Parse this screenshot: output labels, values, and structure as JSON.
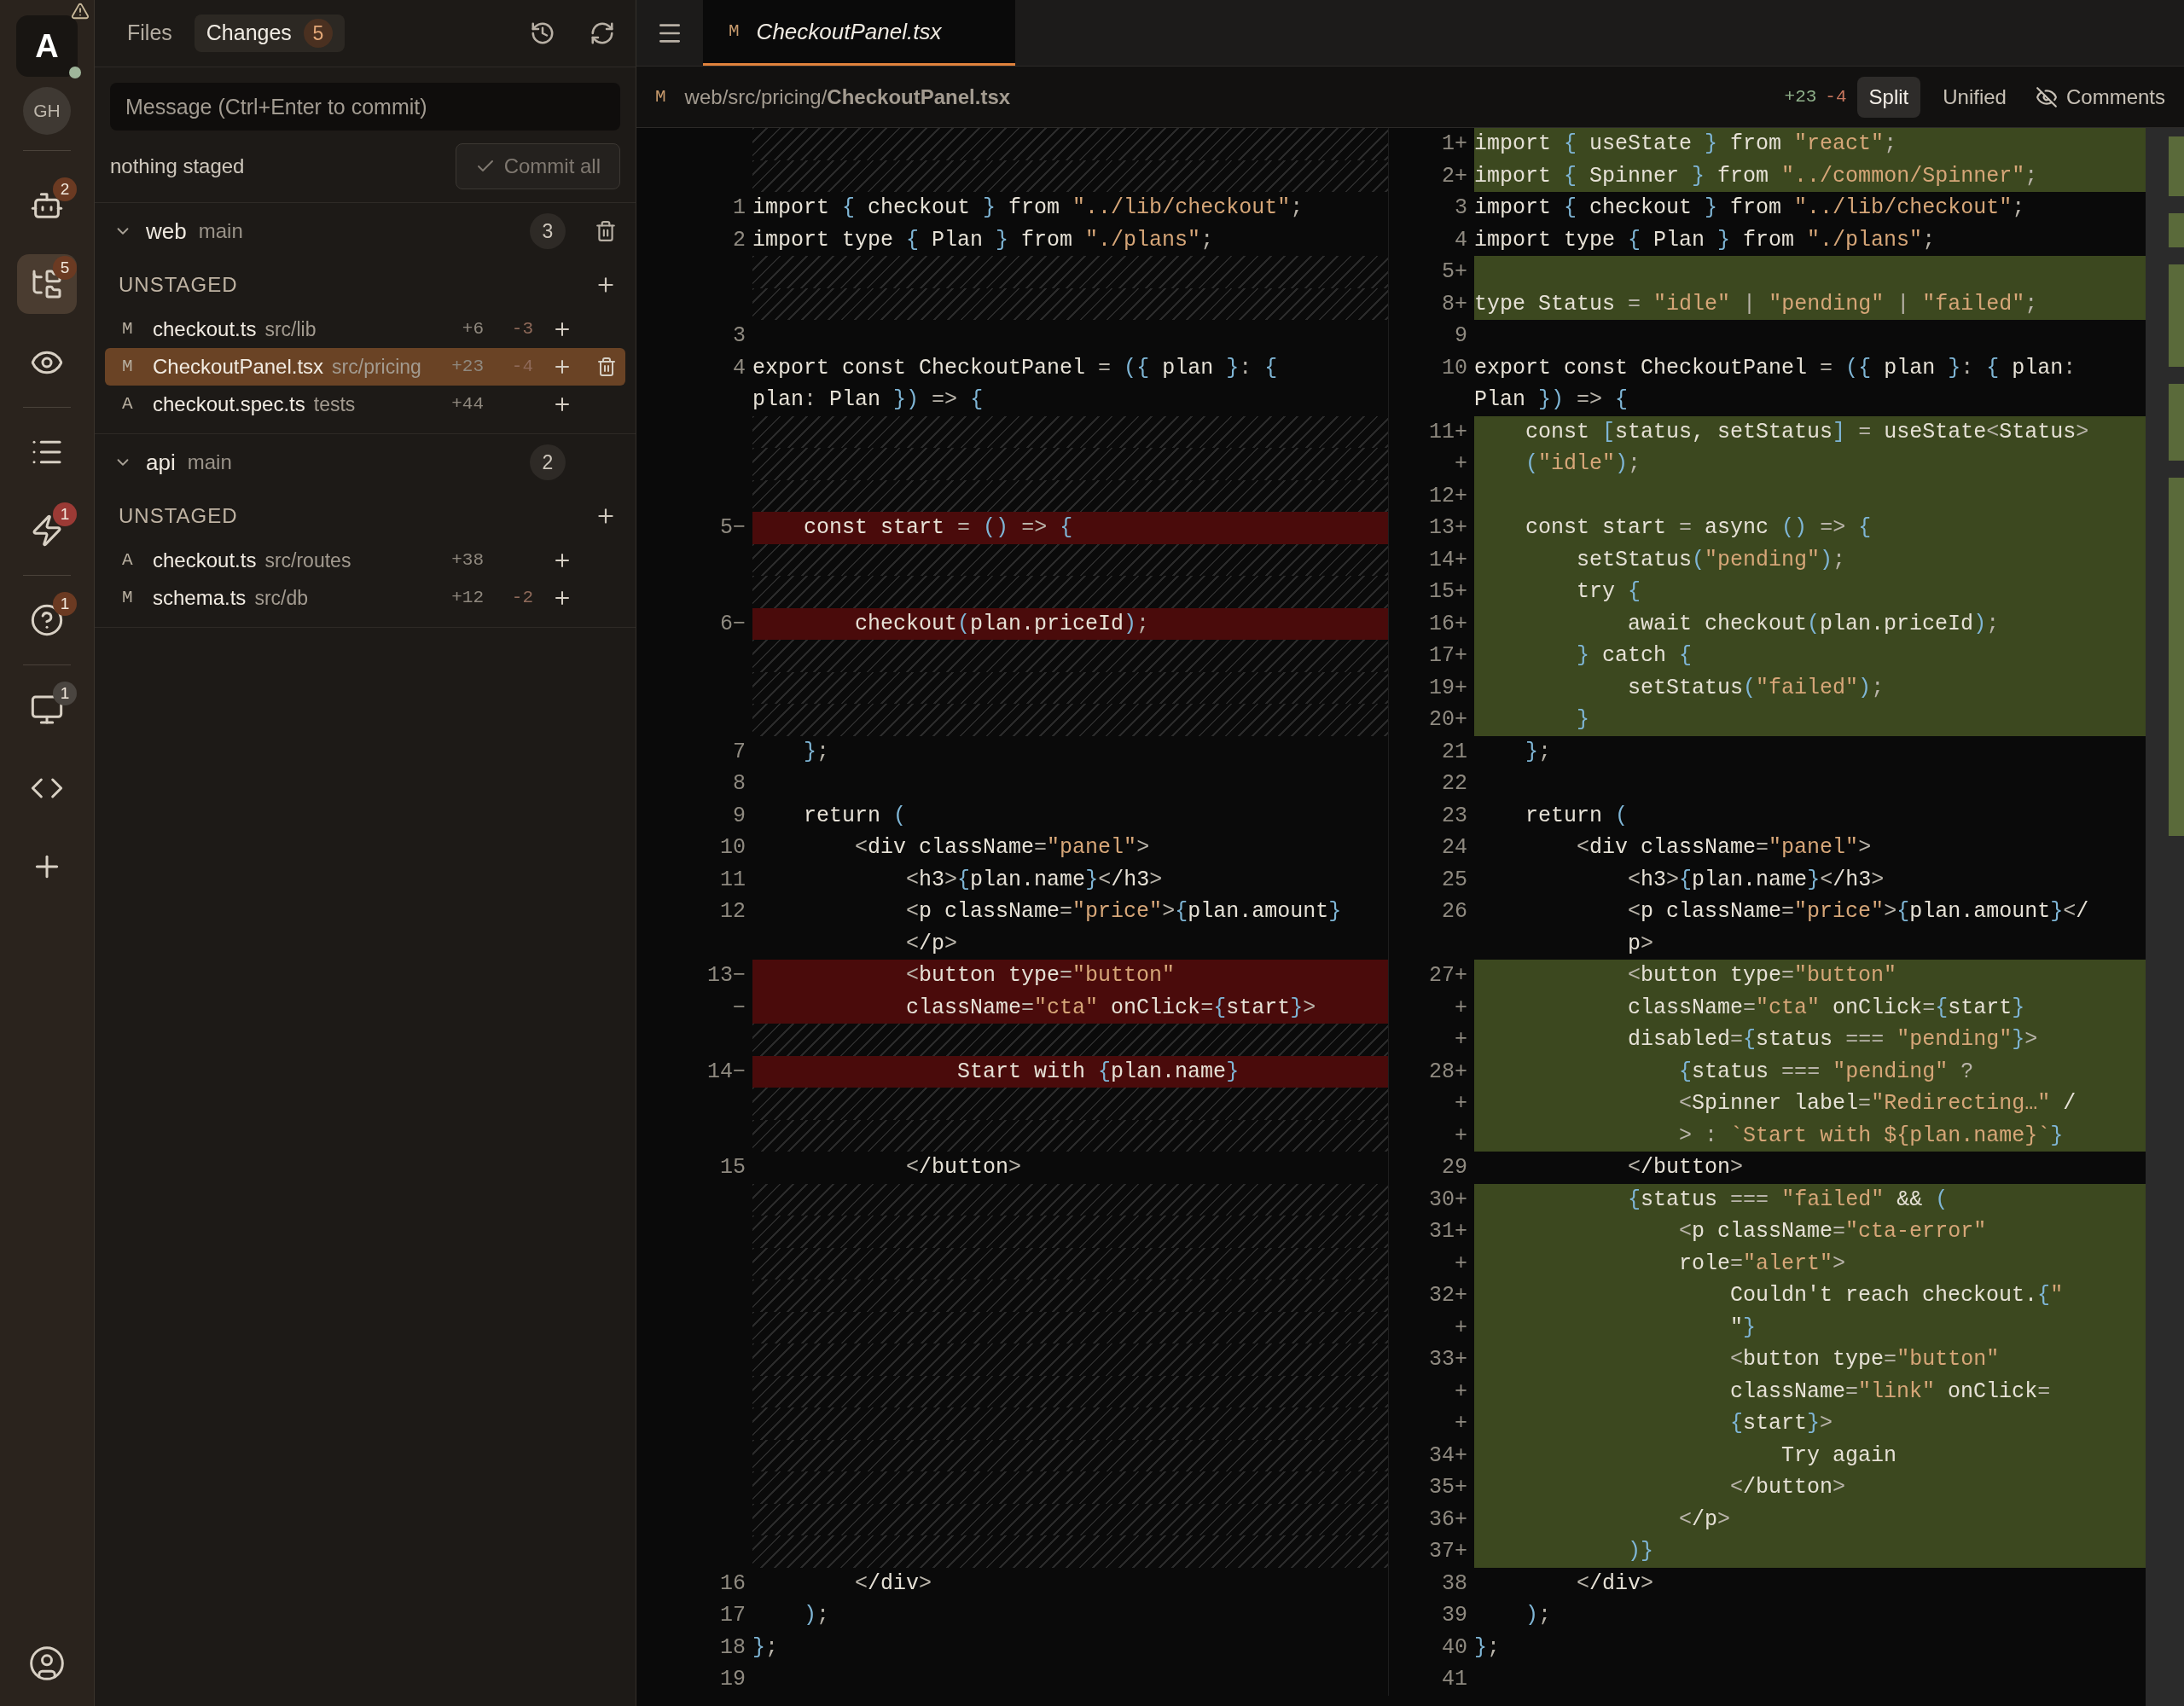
{
  "activity_bar": {
    "workspace": {
      "label": "A",
      "warning": true,
      "online": true
    },
    "account": {
      "label": "GH"
    },
    "items": [
      {
        "badge": "2",
        "color": "#6b3a22",
        "selected": false
      },
      {
        "badge": "5",
        "color": "#6b3a22",
        "selected": true
      },
      {
        "selected": false
      },
      {
        "selected": false
      },
      {
        "badge": "1",
        "color": "#9b3a35",
        "selected": false
      },
      {
        "badge": "1",
        "color": "#6b3a22",
        "selected": false
      },
      {
        "badge": "1",
        "color": "#4a4540",
        "selected": false
      },
      {
        "selected": false
      },
      {
        "selected": false
      }
    ]
  },
  "side_panel": {
    "tabs": [
      {
        "label": "Files",
        "selected": false
      },
      {
        "label": "Changes",
        "count": "5",
        "selected": true
      }
    ],
    "message": {
      "placeholder": "Message (Ctrl+Enter to commit)"
    },
    "staged_status": "nothing staged",
    "commit_button": {
      "label": "Commit all",
      "disabled": true
    },
    "repos": [
      {
        "name": "web",
        "branch": "main",
        "count": "3",
        "expanded": true,
        "active": true,
        "sections": [
          {
            "title": "UNSTAGED",
            "files": [
              {
                "status": "M",
                "name": "checkout.ts",
                "dir": "src/lib",
                "additions": "+6",
                "deletions": "-3",
                "selected": false
              },
              {
                "status": "M",
                "name": "CheckoutPanel.tsx",
                "dir": "src/pricing",
                "additions": "+23",
                "deletions": "-4",
                "selected": true
              },
              {
                "status": "A",
                "name": "checkout.spec.ts",
                "dir": "tests",
                "additions": "+44",
                "selected": false
              }
            ]
          }
        ]
      },
      {
        "name": "api",
        "branch": "main",
        "count": "2",
        "expanded": true,
        "active": false,
        "sections": [
          {
            "title": "UNSTAGED",
            "files": [
              {
                "status": "A",
                "name": "checkout.ts",
                "dir": "src/routes",
                "additions": "+38",
                "selected": false
              },
              {
                "status": "M",
                "name": "schema.ts",
                "dir": "src/db",
                "additions": "+12",
                "deletions": "-2",
                "selected": false
              }
            ]
          }
        ]
      }
    ]
  },
  "editor": {
    "tabs": [
      {
        "status": "M",
        "label": "CheckoutPanel.tsx",
        "selected": true
      }
    ],
    "breadcrumb": {
      "status": "M",
      "path": "web/src/pricing/**CheckoutPanel.tsx**"
    },
    "additions": "+23",
    "deletions": "-4",
    "view_modes": [
      {
        "label": "Split",
        "selected": true
      },
      {
        "label": "Unified",
        "selected": false
      }
    ],
    "comments_button": {
      "label": "Comments"
    },
    "diff": {
      "rows": [
        {
          "left": {
            "kind": "filler"
          },
          "right": {
            "kind": "added",
            "gutter": "1+",
            "text": "import { useState } from \"react\";"
          }
        },
        {
          "left": {
            "kind": "filler"
          },
          "right": {
            "kind": "added",
            "gutter": "2+",
            "text": "import { Spinner } from \"../common/Spinner\";"
          }
        },
        {
          "left": {
            "kind": "context",
            "gutter": "1",
            "text": "import { checkout } from \"../lib/checkout\";"
          },
          "right": {
            "kind": "context",
            "gutter": "3",
            "text": "import { checkout } from \"../lib/checkout\";"
          }
        },
        {
          "left": {
            "kind": "context",
            "gutter": "2",
            "text": "import type { Plan } from \"./plans\";"
          },
          "right": {
            "kind": "context",
            "gutter": "4",
            "text": "import type { Plan } from \"./plans\";"
          }
        },
        {
          "left": {
            "kind": "filler"
          },
          "right": {
            "kind": "added",
            "gutter": "5+"
          }
        },
        {
          "left": {
            "kind": "filler"
          },
          "right": {
            "kind": "added",
            "gutter": "8+",
            "text": "type Status = \"idle\" | \"pending\" | \"failed\";"
          }
        },
        {
          "left": {
            "kind": "context",
            "gutter": "3"
          },
          "right": {
            "kind": "context",
            "gutter": "9"
          }
        },
        {
          "left": {
            "kind": "context",
            "gutter": "4",
            "text": "export const CheckoutPanel = ({ plan }: {"
          },
          "right": {
            "kind": "context",
            "gutter": "10",
            "text": "export const CheckoutPanel = ({ plan }: { plan:"
          }
        },
        {
          "left": {
            "kind": "context",
            "text": "plan: Plan }) => {"
          },
          "right": {
            "kind": "context",
            "text": "Plan }) => {"
          }
        },
        {
          "left": {
            "kind": "filler"
          },
          "right": {
            "kind": "added",
            "gutter": "11+",
            "text": "    const [status, setStatus] = useState<Status>"
          }
        },
        {
          "left": {
            "kind": "filler"
          },
          "right": {
            "kind": "added",
            "gutter": "+",
            "text": "    (\"idle\");"
          }
        },
        {
          "left": {
            "kind": "filler"
          },
          "right": {
            "kind": "added",
            "gutter": "12+"
          }
        },
        {
          "left": {
            "kind": "removed",
            "gutter": "5−",
            "text": "    const start = () => {"
          },
          "right": {
            "kind": "added",
            "gutter": "13+",
            "text": "    const start = async () => {"
          }
        },
        {
          "left": {
            "kind": "filler"
          },
          "right": {
            "kind": "added",
            "gutter": "14+",
            "text": "        setStatus(\"pending\");"
          }
        },
        {
          "left": {
            "kind": "filler"
          },
          "right": {
            "kind": "added",
            "gutter": "15+",
            "text": "        try {"
          }
        },
        {
          "left": {
            "kind": "removed",
            "gutter": "6−",
            "text": "        checkout(plan.priceId);"
          },
          "right": {
            "kind": "added",
            "gutter": "16+",
            "text": "            await checkout(plan.priceId);"
          }
        },
        {
          "left": {
            "kind": "filler"
          },
          "right": {
            "kind": "added",
            "gutter": "17+",
            "text": "        } catch {"
          }
        },
        {
          "left": {
            "kind": "filler"
          },
          "right": {
            "kind": "added",
            "gutter": "19+",
            "text": "            setStatus(\"failed\");"
          }
        },
        {
          "left": {
            "kind": "filler"
          },
          "right": {
            "kind": "added",
            "gutter": "20+",
            "text": "        }"
          }
        },
        {
          "left": {
            "kind": "context",
            "gutter": "7",
            "text": "    };"
          },
          "right": {
            "kind": "context",
            "gutter": "21",
            "text": "    };"
          }
        },
        {
          "left": {
            "kind": "context",
            "gutter": "8"
          },
          "right": {
            "kind": "context",
            "gutter": "22"
          }
        },
        {
          "left": {
            "kind": "context",
            "gutter": "9",
            "text": "    return ("
          },
          "right": {
            "kind": "context",
            "gutter": "23",
            "text": "    return ("
          }
        },
        {
          "left": {
            "kind": "context",
            "gutter": "10",
            "text": "        <div className=\"panel\">"
          },
          "right": {
            "kind": "context",
            "gutter": "24",
            "text": "        <div className=\"panel\">"
          }
        },
        {
          "left": {
            "kind": "context",
            "gutter": "11",
            "text": "            <h3>{plan.name}</h3>"
          },
          "right": {
            "kind": "context",
            "gutter": "25",
            "text": "            <h3>{plan.name}</h3>"
          }
        },
        {
          "left": {
            "kind": "context",
            "gutter": "12",
            "text": "            <p className=\"price\">{plan.amount}"
          },
          "right": {
            "kind": "context",
            "gutter": "26",
            "text": "            <p className=\"price\">{plan.amount}</"
          }
        },
        {
          "left": {
            "kind": "context",
            "text": "            </p>"
          },
          "right": {
            "kind": "context",
            "text": "            p>"
          }
        },
        {
          "left": {
            "kind": "removed",
            "gutter": "13−",
            "text": "            <button type=\"button\""
          },
          "right": {
            "kind": "added",
            "gutter": "27+",
            "text": "            <button type=\"button\""
          }
        },
        {
          "left": {
            "kind": "removed",
            "gutter": "−",
            "text": "            className=\"cta\" onClick={start}>"
          },
          "right": {
            "kind": "added",
            "gutter": "+",
            "text": "            className=\"cta\" onClick={start}"
          }
        },
        {
          "left": {
            "kind": "filler"
          },
          "right": {
            "kind": "added",
            "gutter": "+",
            "text": "            disabled={status === \"pending\"}>"
          }
        },
        {
          "left": {
            "kind": "removed",
            "gutter": "14−",
            "text": "                Start with {plan.name}"
          },
          "right": {
            "kind": "added",
            "gutter": "28+",
            "text": "                {status === \"pending\" ?"
          }
        },
        {
          "left": {
            "kind": "filler"
          },
          "right": {
            "kind": "added",
            "gutter": "+",
            "text": "                <Spinner label=\"Redirecting…\" /"
          }
        },
        {
          "left": {
            "kind": "filler"
          },
          "right": {
            "kind": "added",
            "gutter": "+",
            "text": "                > : `Start with ${plan.name}`}"
          }
        },
        {
          "left": {
            "kind": "context",
            "gutter": "15",
            "text": "            </button>"
          },
          "right": {
            "kind": "context",
            "gutter": "29",
            "text": "            </button>"
          }
        },
        {
          "left": {
            "kind": "filler"
          },
          "right": {
            "kind": "added",
            "gutter": "30+",
            "text": "            {status === \"failed\" && ("
          }
        },
        {
          "left": {
            "kind": "filler"
          },
          "right": {
            "kind": "added",
            "gutter": "31+",
            "text": "                <p className=\"cta-error\""
          }
        },
        {
          "left": {
            "kind": "filler"
          },
          "right": {
            "kind": "added",
            "gutter": "+",
            "text": "                role=\"alert\">"
          }
        },
        {
          "left": {
            "kind": "filler"
          },
          "right": {
            "kind": "added",
            "gutter": "32+",
            "text": "                    Couldn't reach checkout.{\""
          }
        },
        {
          "left": {
            "kind": "filler"
          },
          "right": {
            "kind": "added",
            "gutter": "+",
            "text": "                    \"}"
          }
        },
        {
          "left": {
            "kind": "filler"
          },
          "right": {
            "kind": "added",
            "gutter": "33+",
            "text": "                    <button type=\"button\""
          }
        },
        {
          "left": {
            "kind": "filler"
          },
          "right": {
            "kind": "added",
            "gutter": "+",
            "text": "                    className=\"link\" onClick="
          }
        },
        {
          "left": {
            "kind": "filler"
          },
          "right": {
            "kind": "added",
            "gutter": "+",
            "text": "                    {start}>"
          }
        },
        {
          "left": {
            "kind": "filler"
          },
          "right": {
            "kind": "added",
            "gutter": "34+",
            "text": "                        Try again"
          }
        },
        {
          "left": {
            "kind": "filler"
          },
          "right": {
            "kind": "added",
            "gutter": "35+",
            "text": "                    </button>"
          }
        },
        {
          "left": {
            "kind": "filler"
          },
          "right": {
            "kind": "added",
            "gutter": "36+",
            "text": "                </p>"
          }
        },
        {
          "left": {
            "kind": "filler"
          },
          "right": {
            "kind": "added",
            "gutter": "37+",
            "text": "            )}"
          }
        },
        {
          "left": {
            "kind": "context",
            "gutter": "16",
            "text": "        </div>"
          },
          "right": {
            "kind": "context",
            "gutter": "38",
            "text": "        </div>"
          }
        },
        {
          "left": {
            "kind": "context",
            "gutter": "17",
            "text": "    );"
          },
          "right": {
            "kind": "context",
            "gutter": "39",
            "text": "    );"
          }
        },
        {
          "left": {
            "kind": "context",
            "gutter": "18",
            "text": "};"
          },
          "right": {
            "kind": "context",
            "gutter": "40",
            "text": "};"
          }
        },
        {
          "left": {
            "kind": "context",
            "gutter": "19"
          },
          "right": {
            "kind": "context",
            "gutter": "41"
          }
        }
      ]
    }
  }
}
